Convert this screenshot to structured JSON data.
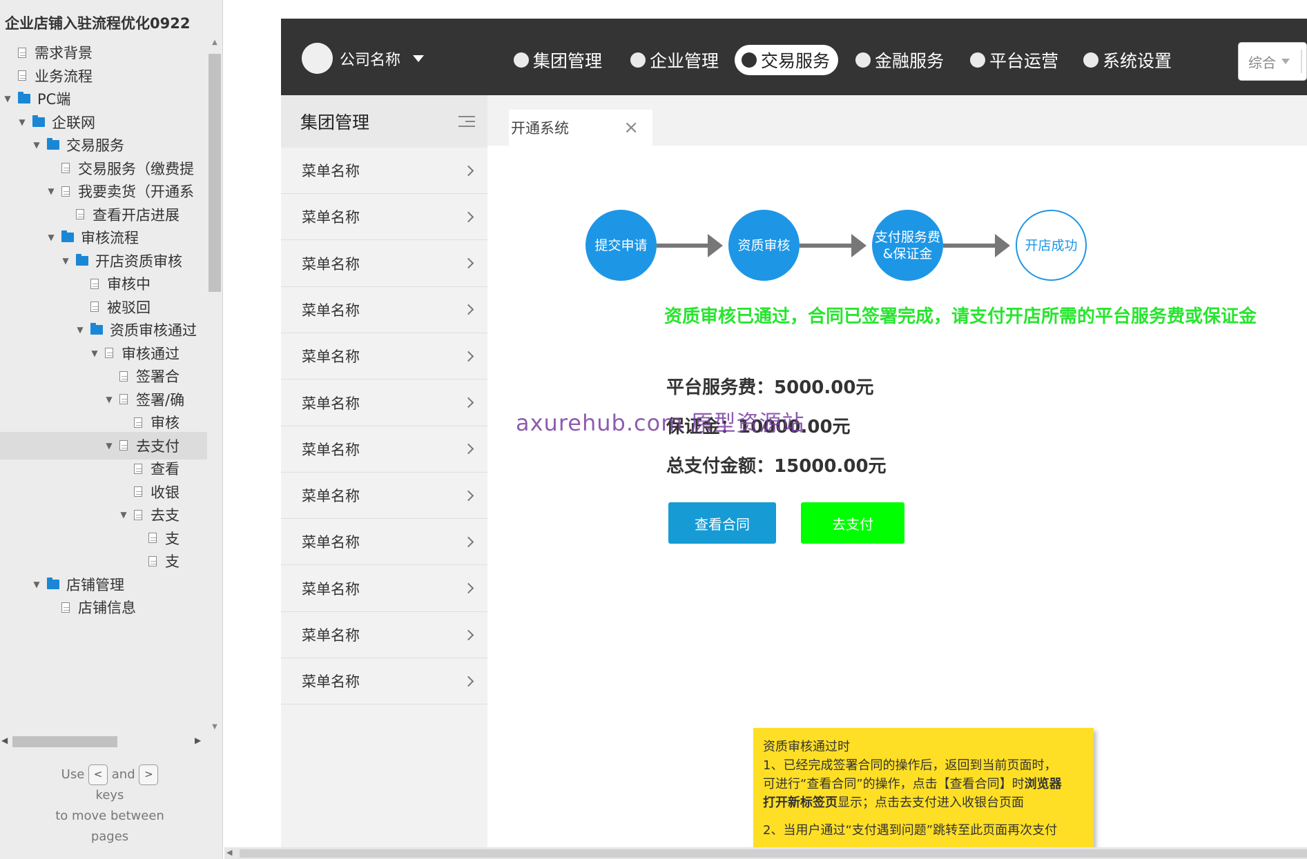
{
  "sitemap": {
    "title": "企业店铺入驻流程优化0922",
    "items": [
      {
        "label": "需求背景",
        "depth": 0,
        "type": "page",
        "toggle": ""
      },
      {
        "label": "业务流程",
        "depth": 0,
        "type": "page",
        "toggle": ""
      },
      {
        "label": "PC端",
        "depth": 0,
        "type": "folder",
        "toggle": "▼"
      },
      {
        "label": "企联网",
        "depth": 1,
        "type": "folder",
        "toggle": "▼"
      },
      {
        "label": "交易服务",
        "depth": 2,
        "type": "folder",
        "toggle": "▼"
      },
      {
        "label": "交易服务（缴费提",
        "depth": 3,
        "type": "page",
        "toggle": ""
      },
      {
        "label": "我要卖货（开通系",
        "depth": 3,
        "type": "page",
        "toggle": "▼"
      },
      {
        "label": "查看开店进展",
        "depth": 4,
        "type": "page",
        "toggle": ""
      },
      {
        "label": "审核流程",
        "depth": 3,
        "type": "folder",
        "toggle": "▼"
      },
      {
        "label": "开店资质审核",
        "depth": 4,
        "type": "folder",
        "toggle": "▼"
      },
      {
        "label": "审核中",
        "depth": 5,
        "type": "page",
        "toggle": ""
      },
      {
        "label": "被驳回",
        "depth": 5,
        "type": "page",
        "toggle": ""
      },
      {
        "label": "资质审核通过",
        "depth": 5,
        "type": "folder",
        "toggle": "▼"
      },
      {
        "label": "审核通过",
        "depth": 6,
        "type": "page",
        "toggle": "▼"
      },
      {
        "label": "签署合",
        "depth": 7,
        "type": "page",
        "toggle": ""
      },
      {
        "label": "签署/确",
        "depth": 7,
        "type": "page",
        "toggle": "▼"
      },
      {
        "label": "审核",
        "depth": 8,
        "type": "page",
        "toggle": ""
      },
      {
        "label": "去支付",
        "depth": 7,
        "type": "page",
        "toggle": "▼",
        "selected": true
      },
      {
        "label": "查看",
        "depth": 8,
        "type": "page",
        "toggle": ""
      },
      {
        "label": "收银",
        "depth": 8,
        "type": "page",
        "toggle": ""
      },
      {
        "label": "去支",
        "depth": 8,
        "type": "page",
        "toggle": "▼"
      },
      {
        "label": "支",
        "depth": 9,
        "type": "page",
        "toggle": ""
      },
      {
        "label": "支",
        "depth": 9,
        "type": "page",
        "toggle": ""
      },
      {
        "label": "店铺管理",
        "depth": 2,
        "type": "folder",
        "toggle": "▼"
      },
      {
        "label": "店铺信息",
        "depth": 3,
        "type": "page",
        "toggle": ""
      }
    ],
    "help": {
      "use": "Use",
      "prev_key": "<",
      "and": "and",
      "next_key": ">",
      "keys": "keys",
      "line3": "to move between",
      "line4": "pages"
    }
  },
  "topbar": {
    "company": "公司名称",
    "tabs": [
      {
        "label": "集团管理",
        "active": false
      },
      {
        "label": "企业管理",
        "active": false
      },
      {
        "label": "交易服务",
        "active": true
      },
      {
        "label": "金融服务",
        "active": false
      },
      {
        "label": "平台运营",
        "active": false
      },
      {
        "label": "系统设置",
        "active": false
      }
    ],
    "search_select": "综合"
  },
  "side_menu": {
    "title": "集团管理",
    "items": [
      "菜单名称",
      "菜单名称",
      "菜单名称",
      "菜单名称",
      "菜单名称",
      "菜单名称",
      "菜单名称",
      "菜单名称",
      "菜单名称",
      "菜单名称",
      "菜单名称",
      "菜单名称"
    ]
  },
  "open_tab": {
    "label": "开通系统",
    "close": "×"
  },
  "steps": [
    {
      "label": "提交申请",
      "done": true
    },
    {
      "label": "资质审核",
      "done": true
    },
    {
      "label": "支付服务费&保证金",
      "line1": "支付服务费",
      "line2": "&保证金",
      "done": true
    },
    {
      "label": "开店成功",
      "done": false
    }
  ],
  "notice": "资质审核已通过，合同已签署完成，请支付开店所需的平台服务费或保证金",
  "fees": {
    "service_label": "平台服务费：",
    "service_value": "5000.00元",
    "deposit_label": "保证金：",
    "deposit_value": "10000.00元",
    "total_label": "总支付金额：",
    "total_value": "15000.00元"
  },
  "buttons": {
    "view_contract": "查看合同",
    "pay": "去支付"
  },
  "watermark": "axurehub.com 原型资源站",
  "sticky_note": {
    "line1": "资质审核通过时",
    "line2": "1、已经完成签署合同的操作后，返回到当前页面时，",
    "line3a": "可进行“查看合同”的操作，点击【查看合同】时",
    "line3b": "浏览器",
    "line4a": "打开新标签页",
    "line4b": "显示；点击去支付进入收银台页面",
    "line5": "2、当用户通过“支付遇到问题”跳转至此页面再次支付"
  },
  "colors": {
    "accent": "#1d96e6",
    "notice": "#27e52e",
    "pay_button": "#00ff00",
    "contract_button": "#169bd5",
    "topbar": "#343434",
    "sticky": "#ffdf25"
  }
}
